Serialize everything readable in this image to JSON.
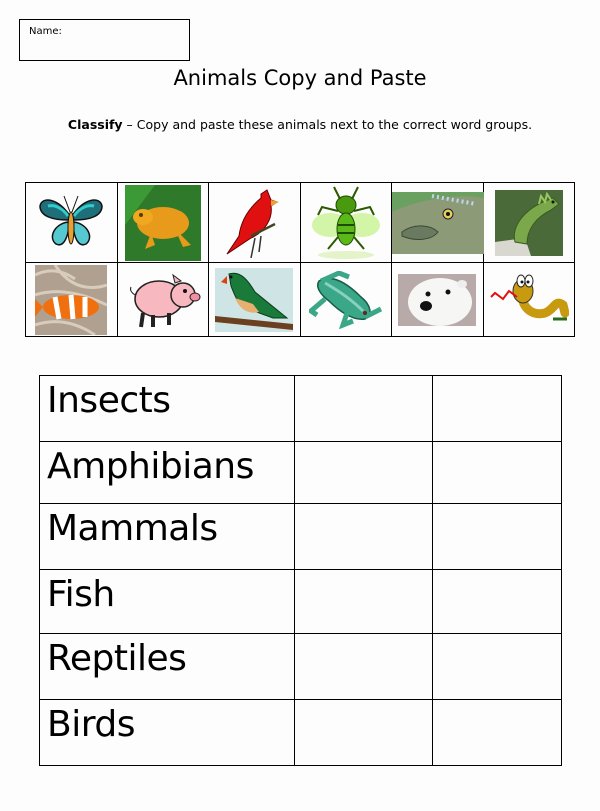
{
  "name_label": "Name:",
  "title": "Animals Copy and Paste",
  "instruction": {
    "bold": "Classify",
    "rest": " – Copy and paste these animals next to the correct word groups."
  },
  "animal_pictures": [
    [
      "butterfly",
      "golden-toad",
      "cardinal",
      "fly",
      "fish",
      "iguana"
    ],
    [
      "clownfish",
      "pig",
      "parrot",
      "frog",
      "polar-bear",
      "snake"
    ]
  ],
  "groups": [
    "Insects",
    "Amphibians",
    "Mammals",
    "Fish",
    "Reptiles",
    "Birds"
  ]
}
